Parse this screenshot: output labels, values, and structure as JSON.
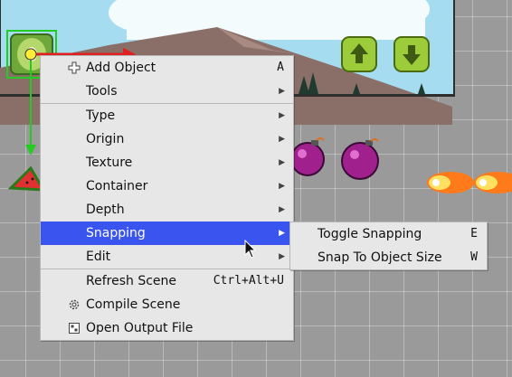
{
  "context_menu": {
    "items": [
      {
        "label": "Add Object",
        "shortcut": "A",
        "icon": "plus-icon"
      },
      {
        "label": "Tools",
        "submenu": true
      },
      {
        "label": "Type",
        "submenu": true
      },
      {
        "label": "Origin",
        "submenu": true
      },
      {
        "label": "Texture",
        "submenu": true
      },
      {
        "label": "Container",
        "submenu": true
      },
      {
        "label": "Depth",
        "submenu": true
      },
      {
        "label": "Snapping",
        "submenu": true,
        "highlighted": true
      },
      {
        "label": "Edit",
        "submenu": true
      },
      {
        "label": "Refresh Scene",
        "shortcut": "Ctrl+Alt+U"
      },
      {
        "label": "Compile Scene",
        "icon": "gear-icon"
      },
      {
        "label": "Open Output File",
        "icon": "file-icon"
      }
    ],
    "submenu_arrow": "▶"
  },
  "snapping_submenu": {
    "items": [
      {
        "label": "Toggle Snapping",
        "shortcut": "E"
      },
      {
        "label": "Snap To Object Size",
        "shortcut": "W"
      }
    ]
  },
  "colors": {
    "menu_bg": "#e7e7e7",
    "highlight": "#3a54f0",
    "grid_bg": "#9a9a9a",
    "selection_green": "#22cc22",
    "sky": "#a6dcf0",
    "mountain": "#8a6e68"
  },
  "scene_objects": [
    "kiwi-sprite",
    "up-arrow-button",
    "down-arrow-button",
    "bomb-sprite",
    "watermelon-sprite",
    "fireball-sprite"
  ]
}
